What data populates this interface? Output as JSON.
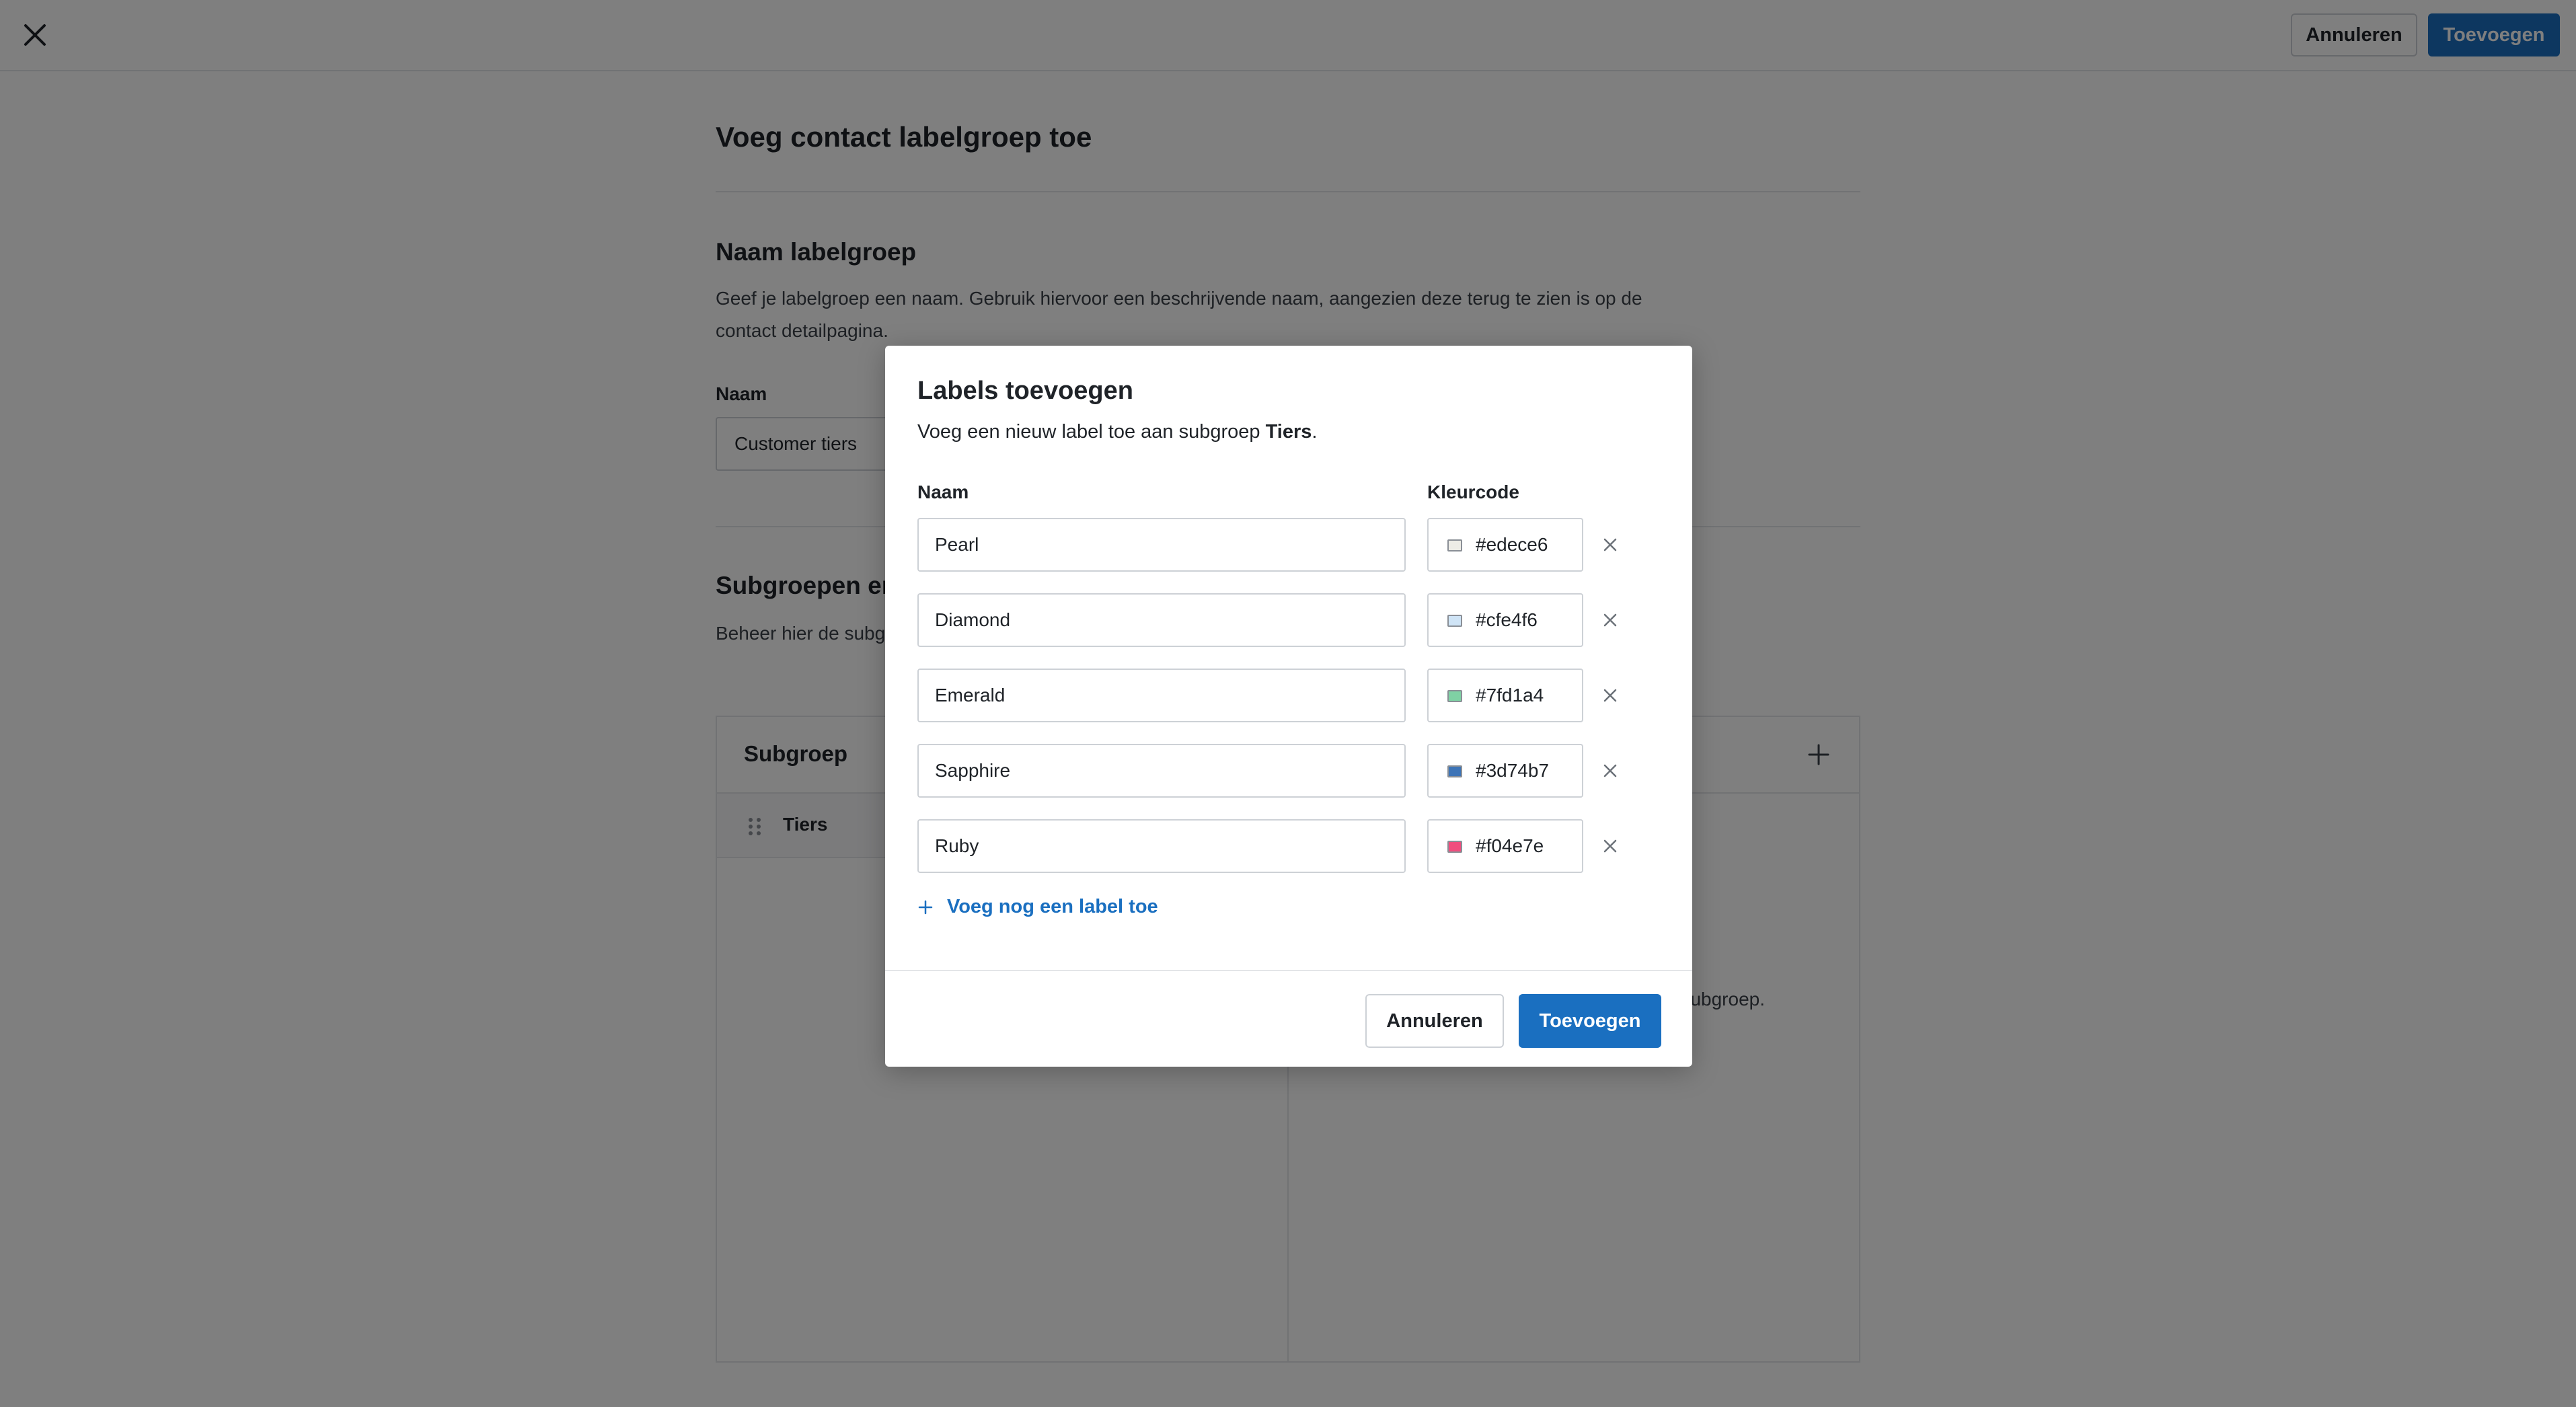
{
  "topbar": {
    "cancel_label": "Annuleren",
    "add_label": "Toevoegen"
  },
  "page": {
    "title": "Voeg contact labelgroep toe",
    "name_section": {
      "title": "Naam labelgroep",
      "description": "Geef je labelgroep een naam. Gebruik hiervoor een beschrijvende naam, aangezien deze terug te zien is op de contact detailpagina.",
      "field_label": "Naam",
      "field_value": "Customer tiers"
    },
    "subgroups_section": {
      "title": "Subgroepen en labels",
      "description": "Beheer hier de subgroepen en labels van deze labelgroep. Een subgroep kan meerdere labels onder zich hebben.",
      "panel_header": "Subgroep",
      "rows": [
        {
          "label": "Tiers"
        }
      ],
      "right_hint": "Voeg een label toe aan deze subgroep."
    }
  },
  "modal": {
    "title": "Labels toevoegen",
    "description_prefix": "Voeg een nieuw label toe aan subgroep ",
    "description_subgroup": "Tiers",
    "description_suffix": ".",
    "col_name": "Naam",
    "col_color": "Kleurcode",
    "labels": [
      {
        "name": "Pearl",
        "color": "#edece6"
      },
      {
        "name": "Diamond",
        "color": "#cfe4f6"
      },
      {
        "name": "Emerald",
        "color": "#7fd1a4"
      },
      {
        "name": "Sapphire",
        "color": "#3d74b7"
      },
      {
        "name": "Ruby",
        "color": "#f04e7e"
      }
    ],
    "add_more_label": "Voeg nog een label toe",
    "cancel_label": "Annuleren",
    "add_label": "Toevoegen"
  },
  "colors": {
    "primary": "#1a6fc0",
    "border": "#cdd1d6",
    "overlay": "rgba(0,0,0,0.5)"
  }
}
